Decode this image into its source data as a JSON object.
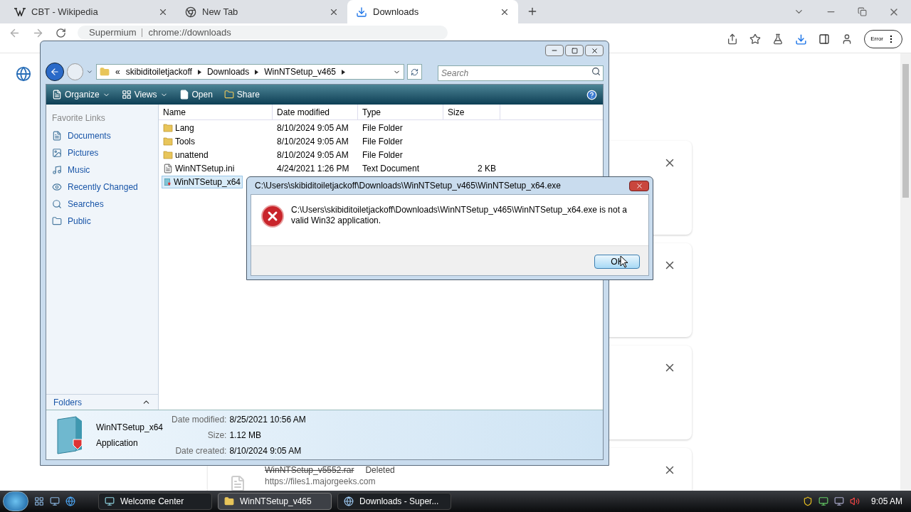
{
  "browser": {
    "tabs": [
      {
        "title": "CBT - Wikipedia",
        "kind": "wiki",
        "selected": false
      },
      {
        "title": "New Tab",
        "kind": "newtab",
        "selected": false
      },
      {
        "title": "Downloads",
        "kind": "downloads",
        "selected": true
      }
    ],
    "address": {
      "brand": "Supermium",
      "url": "chrome://downloads"
    },
    "profile_badge": "Error",
    "cards": [
      {
        "kind": "hidden"
      },
      {
        "kind": "hidden"
      },
      {
        "kind": "hidden"
      },
      {
        "kind": "item",
        "file": "WinNTSetup_v5552.rar",
        "status": "Deleted",
        "url": "https://files1.majorgeeks.com"
      }
    ]
  },
  "explorer": {
    "breadcrumb": [
      "«",
      "skibiditoiletjackoff",
      "Downloads",
      "WinNTSetup_v465"
    ],
    "search": {
      "placeholder": "Search"
    },
    "toolbar": [
      {
        "label": "Organize",
        "kind": "menu"
      },
      {
        "label": "Views",
        "kind": "menu"
      },
      {
        "label": "Open",
        "kind": "plain"
      },
      {
        "label": "Share",
        "kind": "plain"
      }
    ],
    "favorite_links": {
      "title": "Favorite Links",
      "items": [
        "Documents",
        "Pictures",
        "Music",
        "Recently Changed",
        "Searches",
        "Public"
      ]
    },
    "folders_label": "Folders",
    "columns": [
      "Name",
      "Date modified",
      "Type",
      "Size"
    ],
    "files": [
      {
        "name": "Lang",
        "date": "8/10/2024 9:05 AM",
        "type": "File Folder",
        "kind": "folder",
        "selected": false
      },
      {
        "name": "Tools",
        "date": "8/10/2024 9:05 AM",
        "type": "File Folder",
        "kind": "folder",
        "selected": false
      },
      {
        "name": "unattend",
        "date": "8/10/2024 9:05 AM",
        "type": "File Folder",
        "kind": "folder",
        "selected": false
      },
      {
        "name": "WinNTSetup.ini",
        "date": "4/24/2021 1:26 PM",
        "type": "Text Document",
        "size": "2 KB",
        "kind": "text",
        "selected": false
      },
      {
        "name": "WinNTSetup_x64",
        "kind": "app",
        "selected": true
      }
    ],
    "details": {
      "name": "WinNTSetup_x64",
      "type": "Application",
      "fields": [
        {
          "label": "Date modified:",
          "value": "8/25/2021 10:56 AM"
        },
        {
          "label": "Size:",
          "value": "1.12 MB"
        },
        {
          "label": "Date created:",
          "value": "8/10/2024 9:05 AM"
        }
      ]
    }
  },
  "dialog": {
    "title": "C:\\Users\\skibiditoiletjackoff\\Downloads\\WinNTSetup_v465\\WinNTSetup_x64.exe",
    "message": "C:\\Users\\skibiditoiletjackoff\\Downloads\\WinNTSetup_v465\\WinNTSetup_x64.exe is not a valid Win32 application.",
    "button": "OK"
  },
  "taskbar": {
    "buttons": [
      {
        "label": "Welcome Center",
        "kind": "app",
        "selected": false
      },
      {
        "label": "WinNTSetup_v465",
        "kind": "folder",
        "selected": true
      },
      {
        "label": "Downloads - Super...",
        "kind": "browser",
        "selected": false
      }
    ],
    "clock": "9:05 AM"
  }
}
